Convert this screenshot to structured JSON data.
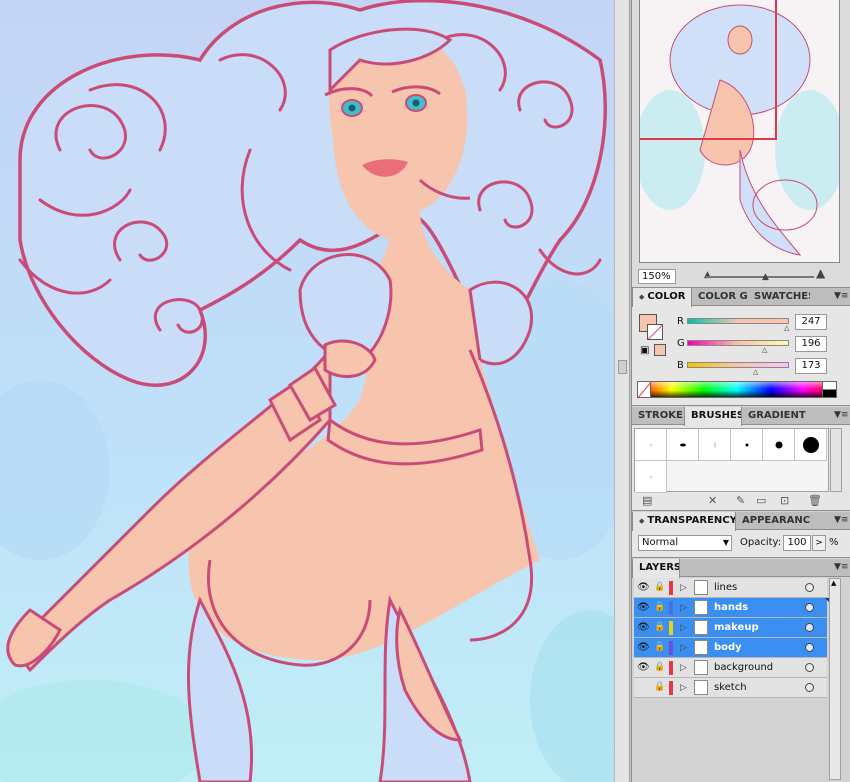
{
  "navigator": {
    "zoom": "150%"
  },
  "color": {
    "tabs": [
      "COLOR",
      "COLOR GU",
      "SWATCHES"
    ],
    "active_tab": "COLOR",
    "fill_hex": "#f7c4ad",
    "channels": [
      {
        "label": "R",
        "value": "247"
      },
      {
        "label": "G",
        "value": "196"
      },
      {
        "label": "B",
        "value": "173"
      }
    ]
  },
  "brushes": {
    "tabs": [
      "STROKE",
      "BRUSHES",
      "GRADIENT"
    ],
    "active_tab": "BRUSHES"
  },
  "transparency": {
    "tabs": [
      "TRANSPARENCY",
      "APPEARANCE"
    ],
    "active_tab": "TRANSPARENCY",
    "blend_mode": "Normal",
    "opacity_label": "Opacity:",
    "opacity_value": "100",
    "opacity_unit": "%"
  },
  "layers": {
    "title": "LAYERS",
    "items": [
      {
        "name": "lines",
        "visible": true,
        "selected": false,
        "color": "#e03a4a"
      },
      {
        "name": "hands",
        "visible": true,
        "selected": true,
        "color": "#4a6fe0"
      },
      {
        "name": "makeup",
        "visible": true,
        "selected": true,
        "color": "#e6d21a"
      },
      {
        "name": "body",
        "visible": true,
        "selected": true,
        "color": "#6a4fd8"
      },
      {
        "name": "background",
        "visible": true,
        "selected": false,
        "color": "#e03a4a"
      },
      {
        "name": "sketch",
        "visible": false,
        "selected": false,
        "color": "#e03a4a"
      }
    ]
  },
  "colors": {
    "line_art": "#c94c78",
    "skin": "#f7c4ad",
    "hair": "#c9dcf8",
    "selection": "#3a8ff0"
  }
}
